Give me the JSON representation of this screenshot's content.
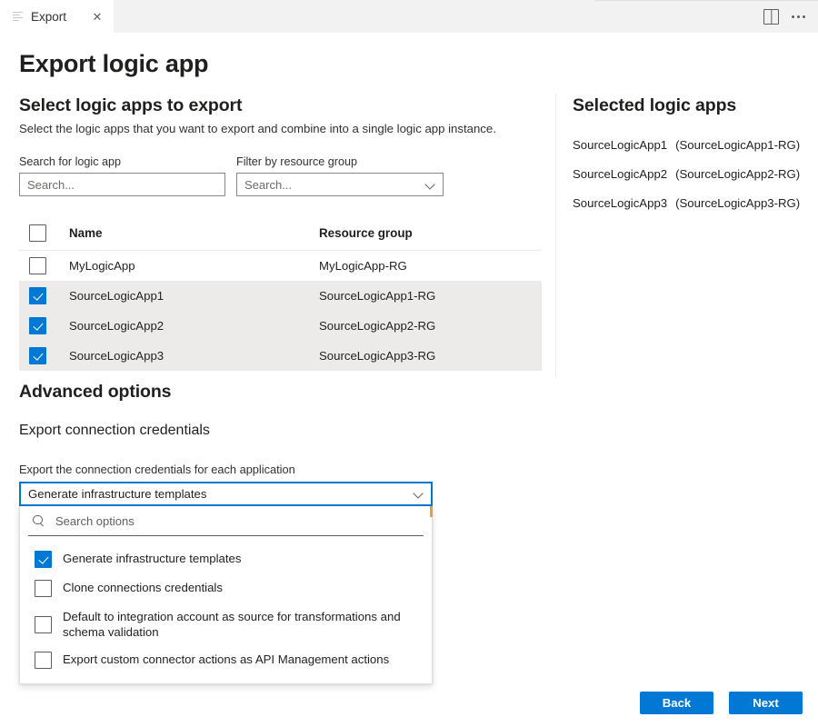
{
  "tab": {
    "label": "Export",
    "close_label": "✕",
    "icon": "list-icon"
  },
  "titlebar": {
    "split_view_icon": "split-view-icon",
    "more_icon": "more-ellipsis-icon"
  },
  "page": {
    "title": "Export logic app"
  },
  "select_section": {
    "heading": "Select logic apps to export",
    "description": "Select the logic apps that you want to export and combine into a single logic app instance.",
    "search_label": "Search for logic app",
    "search_placeholder": "Search...",
    "filter_label": "Filter by resource group",
    "filter_placeholder": "Search..."
  },
  "table": {
    "columns": [
      "Name",
      "Resource group"
    ],
    "header_checkbox_checked": false,
    "rows": [
      {
        "checked": false,
        "name": "MyLogicApp",
        "resource_group": "MyLogicApp-RG"
      },
      {
        "checked": true,
        "name": "SourceLogicApp1",
        "resource_group": "SourceLogicApp1-RG"
      },
      {
        "checked": true,
        "name": "SourceLogicApp2",
        "resource_group": "SourceLogicApp2-RG"
      },
      {
        "checked": true,
        "name": "SourceLogicApp3",
        "resource_group": "SourceLogicApp3-RG"
      }
    ]
  },
  "selected_panel": {
    "heading": "Selected logic apps",
    "items": [
      {
        "name": "SourceLogicApp1",
        "resource_group": "(SourceLogicApp1-RG)"
      },
      {
        "name": "SourceLogicApp2",
        "resource_group": "(SourceLogicApp2-RG)"
      },
      {
        "name": "SourceLogicApp3",
        "resource_group": "(SourceLogicApp3-RG)"
      }
    ]
  },
  "advanced": {
    "heading": "Advanced options",
    "subheading": "Export connection credentials",
    "field_label": "Export the connection credentials for each application",
    "combo_value": "Generate infrastructure templates",
    "chevron_icon": "chevron-down-icon"
  },
  "dropdown": {
    "search_icon": "search-icon",
    "search_placeholder": "Search options",
    "options": [
      {
        "label": "Generate infrastructure templates",
        "checked": true
      },
      {
        "label": "Clone connections credentials",
        "checked": false
      },
      {
        "label": "Default to integration account as source for transformations and schema validation",
        "checked": false
      },
      {
        "label": "Export custom connector actions as API Management actions",
        "checked": false
      }
    ]
  },
  "footer": {
    "back_label": "Back",
    "next_label": "Next"
  },
  "colors": {
    "accent": "#0078d4",
    "tabbar_bg": "#f2f2f2",
    "row_selected_bg": "#edebe9",
    "text": "#201f1e"
  }
}
